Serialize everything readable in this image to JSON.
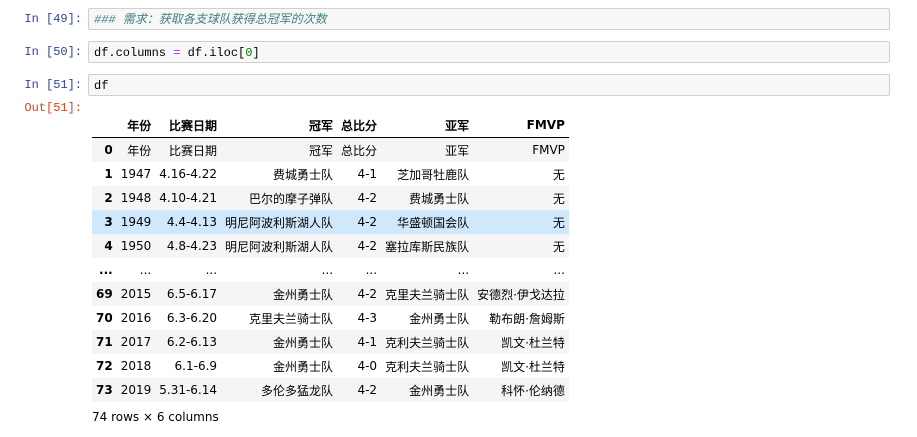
{
  "cells": [
    {
      "prompt": "In  [49]:",
      "parts": [
        {
          "t": "### 需求：获取各支球队获得总冠军的次数",
          "c": "comment"
        }
      ]
    },
    {
      "prompt": "In  [50]:",
      "parts": [
        {
          "t": "df.columns ",
          "c": ""
        },
        {
          "t": "=",
          "c": "op"
        },
        {
          "t": " df.iloc[",
          "c": ""
        },
        {
          "t": "0",
          "c": "num"
        },
        {
          "t": "]",
          "c": ""
        }
      ]
    },
    {
      "prompt": "In  [51]:",
      "parts": [
        {
          "t": "df",
          "c": ""
        }
      ]
    }
  ],
  "output_prompt": "Out[51]:",
  "table": {
    "columns": [
      "",
      "年份",
      "比赛日期",
      "冠军",
      "总比分",
      "亚军",
      "FMVP"
    ],
    "rows": [
      [
        "0",
        "年份",
        "比赛日期",
        "冠军",
        "总比分",
        "亚军",
        "FMVP"
      ],
      [
        "1",
        "1947",
        "4.16-4.22",
        "费城勇士队",
        "4-1",
        "芝加哥牡鹿队",
        "无"
      ],
      [
        "2",
        "1948",
        "4.10-4.21",
        "巴尔的摩子弹队",
        "4-2",
        "费城勇士队",
        "无"
      ],
      [
        "3",
        "1949",
        "4.4-4.13",
        "明尼阿波利斯湖人队",
        "4-2",
        "华盛顿国会队",
        "无"
      ],
      [
        "4",
        "1950",
        "4.8-4.23",
        "明尼阿波利斯湖人队",
        "4-2",
        "塞拉库斯民族队",
        "无"
      ],
      [
        "...",
        "...",
        "...",
        "...",
        "...",
        "...",
        "..."
      ],
      [
        "69",
        "2015",
        "6.5-6.17",
        "金州勇士队",
        "4-2",
        "克里夫兰骑士队",
        "安德烈·伊戈达拉"
      ],
      [
        "70",
        "2016",
        "6.3-6.20",
        "克里夫兰骑士队",
        "4-3",
        "金州勇士队",
        "勒布朗·詹姆斯"
      ],
      [
        "71",
        "2017",
        "6.2-6.13",
        "金州勇士队",
        "4-1",
        "克利夫兰骑士队",
        "凯文·杜兰特"
      ],
      [
        "72",
        "2018",
        "6.1-6.9",
        "金州勇士队",
        "4-0",
        "克利夫兰骑士队",
        "凯文·杜兰特"
      ],
      [
        "73",
        "2019",
        "5.31-6.14",
        "多伦多猛龙队",
        "4-2",
        "金州勇士队",
        "科怀·伦纳德"
      ]
    ],
    "highlighted_row": 3,
    "footer": "74 rows × 6 columns"
  }
}
